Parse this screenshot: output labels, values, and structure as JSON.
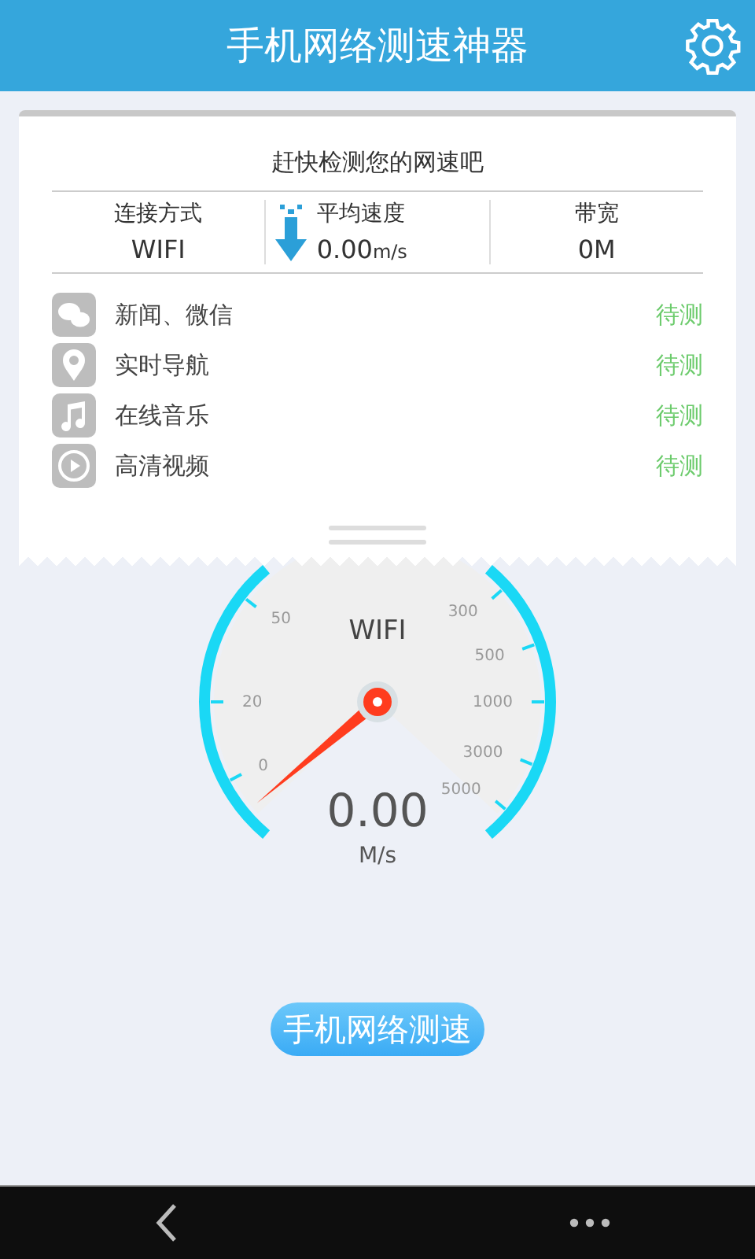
{
  "app_bar": {
    "title": "手机网络测速神器"
  },
  "summary": {
    "heading": "赶快检测您的网速吧",
    "stats": [
      {
        "kind": "plain",
        "label": "连接方式",
        "value": "WIFI"
      },
      {
        "kind": "speed",
        "label": "平均速度",
        "value": "0.00",
        "unit": "m/s"
      },
      {
        "kind": "plain",
        "label": "带宽",
        "value": "0M"
      }
    ]
  },
  "tests": [
    {
      "kind": "chat",
      "name": "新闻、微信",
      "status": "待测"
    },
    {
      "kind": "pin",
      "name": "实时导航",
      "status": "待测"
    },
    {
      "kind": "music",
      "name": "在线音乐",
      "status": "待测"
    },
    {
      "kind": "video",
      "name": "高清视频",
      "status": "待测"
    }
  ],
  "gauge": {
    "network": "WIFI",
    "value": "0.00",
    "unit": "M/s",
    "left_ticks": [
      "0",
      "20",
      "50"
    ],
    "right_ticks": [
      "300",
      "500",
      "1000",
      "3000",
      "5000"
    ]
  },
  "start_button": "手机网络测速"
}
